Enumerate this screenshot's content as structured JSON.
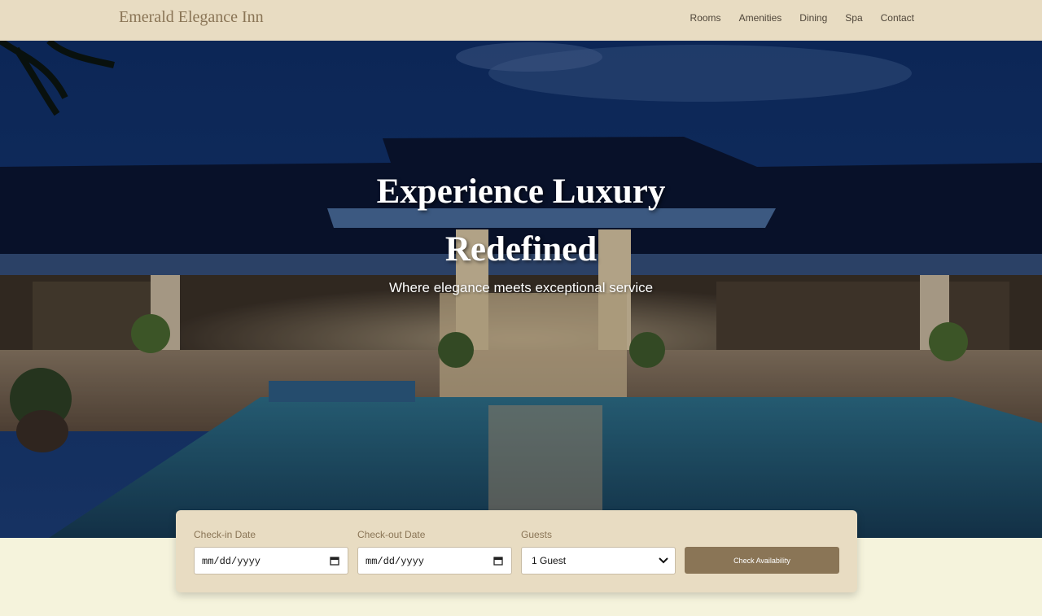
{
  "brand": "Emerald Elegance Inn",
  "nav": [
    "Rooms",
    "Amenities",
    "Dining",
    "Spa",
    "Contact"
  ],
  "hero": {
    "title_line1": "Experience Luxury",
    "title_line2": "Redefined",
    "subtitle": "Where elegance meets exceptional service"
  },
  "booking": {
    "checkin_label": "Check-in Date",
    "checkin_value": "mm/dd/yyyy",
    "checkout_label": "Check-out Date",
    "checkout_value": "mm/dd/yyyy",
    "guests_label": "Guests",
    "guests_value": "1 Guest",
    "button": "Check Availability"
  },
  "colors": {
    "nav_bg": "#e8dcc2",
    "brand": "#8a7556",
    "button": "#8a7556",
    "page_bg": "#f5f3dc"
  },
  "icons": [
    "calendar-icon",
    "calendar-icon",
    "chevron-down-icon"
  ]
}
